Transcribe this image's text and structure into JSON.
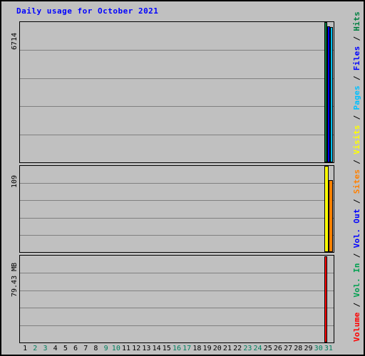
{
  "title": "Daily usage for October 2021",
  "colors": {
    "background": "#c0c0c0",
    "border": "#000000",
    "grid": "#808080",
    "title": "#0000ff",
    "hits": "#007f40",
    "files": "#0000ff",
    "pages": "#00c0ff",
    "visits": "#ffff00",
    "sites": "#ff8000",
    "vol_out": "#0000ff",
    "vol_in": "#00a050",
    "volume": "#ff0000",
    "weekend_label": "#00805f",
    "weekday_label": "#000000"
  },
  "axes": {
    "y_hits_max": "6714",
    "y_visits_max": "109",
    "y_volume_max": "79.43 MB"
  },
  "legend": {
    "items": [
      {
        "label": "Volume",
        "color": "#ff0000"
      },
      {
        "label": "Vol. In",
        "color": "#00a050"
      },
      {
        "label": "Vol. Out",
        "color": "#0000ff"
      },
      {
        "label": "Sites",
        "color": "#ff8000"
      },
      {
        "label": "Visits",
        "color": "#ffff00"
      },
      {
        "label": "Pages",
        "color": "#00c0ff"
      },
      {
        "label": "Files",
        "color": "#0000ff"
      },
      {
        "label": "Hits",
        "color": "#007f40"
      }
    ],
    "separator": " / "
  },
  "x_axis": {
    "days": [
      {
        "label": "1",
        "weekend": false
      },
      {
        "label": "2",
        "weekend": true
      },
      {
        "label": "3",
        "weekend": true
      },
      {
        "label": "4",
        "weekend": false
      },
      {
        "label": "5",
        "weekend": false
      },
      {
        "label": "6",
        "weekend": false
      },
      {
        "label": "7",
        "weekend": false
      },
      {
        "label": "8",
        "weekend": false
      },
      {
        "label": "9",
        "weekend": true
      },
      {
        "label": "10",
        "weekend": true
      },
      {
        "label": "11",
        "weekend": false
      },
      {
        "label": "12",
        "weekend": false
      },
      {
        "label": "13",
        "weekend": false
      },
      {
        "label": "14",
        "weekend": false
      },
      {
        "label": "15",
        "weekend": false
      },
      {
        "label": "16",
        "weekend": true
      },
      {
        "label": "17",
        "weekend": true
      },
      {
        "label": "18",
        "weekend": false
      },
      {
        "label": "19",
        "weekend": false
      },
      {
        "label": "20",
        "weekend": false
      },
      {
        "label": "21",
        "weekend": false
      },
      {
        "label": "22",
        "weekend": false
      },
      {
        "label": "23",
        "weekend": true
      },
      {
        "label": "24",
        "weekend": true
      },
      {
        "label": "25",
        "weekend": false
      },
      {
        "label": "26",
        "weekend": false
      },
      {
        "label": "27",
        "weekend": false
      },
      {
        "label": "28",
        "weekend": false
      },
      {
        "label": "29",
        "weekend": false
      },
      {
        "label": "30",
        "weekend": true
      },
      {
        "label": "31",
        "weekend": true
      }
    ]
  },
  "chart_data": {
    "type": "bar",
    "title": "Daily usage for October 2021",
    "xlabel": "",
    "ylabel": "Hits / Files / Pages  |  Visits / Sites  |  Volume",
    "grid": true,
    "legend_position": "right-rotated",
    "categories": [
      "1",
      "2",
      "3",
      "4",
      "5",
      "6",
      "7",
      "8",
      "9",
      "10",
      "11",
      "12",
      "13",
      "14",
      "15",
      "16",
      "17",
      "18",
      "19",
      "20",
      "21",
      "22",
      "23",
      "24",
      "25",
      "26",
      "27",
      "28",
      "29",
      "30",
      "31"
    ],
    "panels": [
      {
        "name": "hits-files-pages",
        "ymax": 6714,
        "ymax_label": "6714",
        "gridlines": 5,
        "series": [
          {
            "name": "Hits",
            "color": "#007f40",
            "values": [
              0,
              0,
              0,
              0,
              0,
              0,
              0,
              0,
              0,
              0,
              0,
              0,
              0,
              0,
              0,
              0,
              0,
              0,
              0,
              0,
              0,
              0,
              0,
              0,
              0,
              0,
              0,
              0,
              0,
              0,
              6714
            ]
          },
          {
            "name": "Files",
            "color": "#0000ff",
            "values": [
              0,
              0,
              0,
              0,
              0,
              0,
              0,
              0,
              0,
              0,
              0,
              0,
              0,
              0,
              0,
              0,
              0,
              0,
              0,
              0,
              0,
              0,
              0,
              0,
              0,
              0,
              0,
              0,
              0,
              0,
              6520
            ]
          },
          {
            "name": "Pages",
            "color": "#00c0ff",
            "values": [
              0,
              0,
              0,
              0,
              0,
              0,
              0,
              0,
              0,
              0,
              0,
              0,
              0,
              0,
              0,
              0,
              0,
              0,
              0,
              0,
              0,
              0,
              0,
              0,
              0,
              0,
              0,
              0,
              0,
              0,
              6480
            ]
          }
        ]
      },
      {
        "name": "visits-sites",
        "ymax": 109,
        "ymax_label": "109",
        "gridlines": 5,
        "series": [
          {
            "name": "Visits",
            "color": "#ffff00",
            "values": [
              0,
              0,
              0,
              0,
              0,
              0,
              0,
              0,
              0,
              0,
              0,
              0,
              0,
              0,
              0,
              0,
              0,
              0,
              0,
              0,
              0,
              0,
              0,
              0,
              0,
              0,
              0,
              0,
              0,
              0,
              109
            ]
          },
          {
            "name": "Sites",
            "color": "#ff8000",
            "values": [
              0,
              0,
              0,
              0,
              0,
              0,
              0,
              0,
              0,
              0,
              0,
              0,
              0,
              0,
              0,
              0,
              0,
              0,
              0,
              0,
              0,
              0,
              0,
              0,
              0,
              0,
              0,
              0,
              0,
              0,
              91
            ]
          }
        ]
      },
      {
        "name": "volume",
        "ymax": 79.43,
        "ymax_label": "79.43 MB",
        "gridlines": 5,
        "series": [
          {
            "name": "Volume",
            "color": "#ff0000",
            "values": [
              0,
              0,
              0,
              0,
              0,
              0,
              0,
              0,
              0,
              0,
              0,
              0,
              0,
              0,
              0,
              0,
              0,
              0,
              0,
              0,
              0,
              0,
              0,
              0,
              0,
              0,
              0,
              0,
              0,
              0,
              78.5
            ]
          },
          {
            "name": "Vol. In",
            "color": "#00a050",
            "values": [
              0,
              0,
              0,
              0,
              0,
              0,
              0,
              0,
              0,
              0,
              0,
              0,
              0,
              0,
              0,
              0,
              0,
              0,
              0,
              0,
              0,
              0,
              0,
              0,
              0,
              0,
              0,
              0,
              0,
              0,
              0
            ]
          },
          {
            "name": "Vol. Out",
            "color": "#0000ff",
            "values": [
              0,
              0,
              0,
              0,
              0,
              0,
              0,
              0,
              0,
              0,
              0,
              0,
              0,
              0,
              0,
              0,
              0,
              0,
              0,
              0,
              0,
              0,
              0,
              0,
              0,
              0,
              0,
              0,
              0,
              0,
              0
            ]
          }
        ]
      }
    ]
  }
}
